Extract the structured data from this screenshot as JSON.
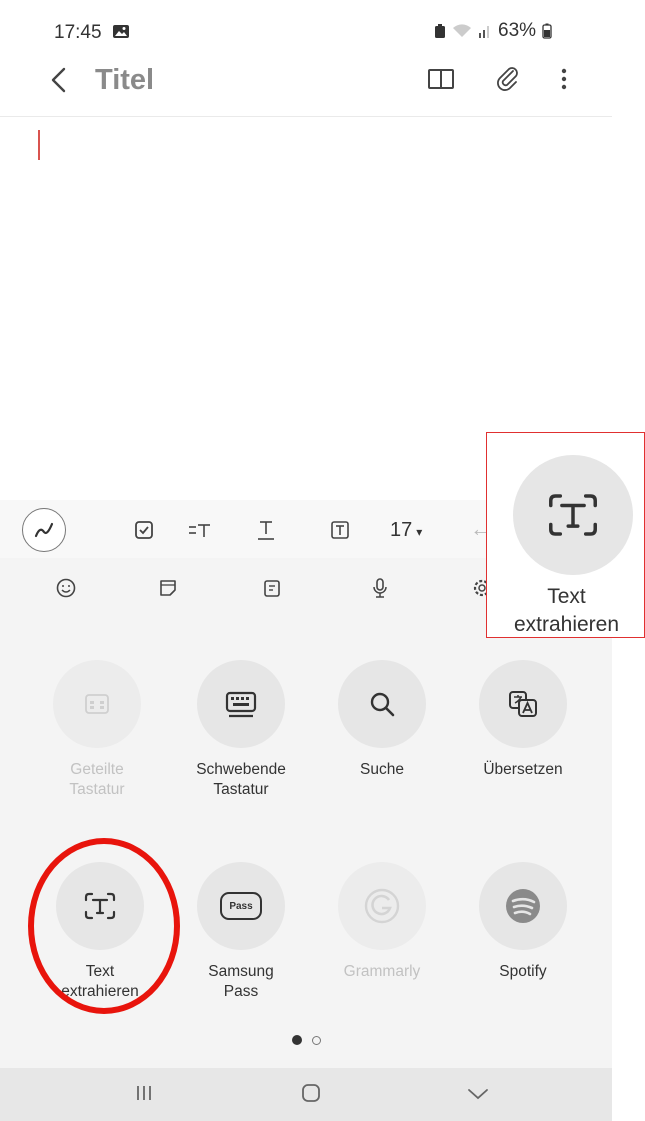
{
  "status_bar": {
    "time": "17:45",
    "battery": "63%"
  },
  "header": {
    "title": "Titel"
  },
  "toolbar": {
    "font_size": "17"
  },
  "apps_row1": [
    {
      "label_line1": "Geteilte",
      "label_line2": "Tastatur",
      "enabled": false,
      "icon": "split-keyboard-icon"
    },
    {
      "label_line1": "Schwebende",
      "label_line2": "Tastatur",
      "enabled": true,
      "icon": "floating-keyboard-icon"
    },
    {
      "label_line1": "Suche",
      "label_line2": "",
      "enabled": true,
      "icon": "search-icon"
    },
    {
      "label_line1": "Übersetzen",
      "label_line2": "",
      "enabled": true,
      "icon": "translate-icon"
    }
  ],
  "apps_row2": [
    {
      "label_line1": "Text",
      "label_line2": "extrahieren",
      "enabled": true,
      "icon": "extract-text-icon"
    },
    {
      "label_line1": "Samsung",
      "label_line2": "Pass",
      "enabled": true,
      "icon": "samsung-pass-icon",
      "badge": "Pass"
    },
    {
      "label_line1": "Grammarly",
      "label_line2": "",
      "enabled": false,
      "icon": "grammarly-icon"
    },
    {
      "label_line1": "Spotify",
      "label_line2": "",
      "enabled": true,
      "icon": "spotify-icon"
    }
  ],
  "pagination": {
    "current": 1,
    "total": 2
  },
  "callout": {
    "label_line1": "Text",
    "label_line2": "extrahieren"
  },
  "colors": {
    "annotation": "#e8140c",
    "cursor": "#d9534f"
  }
}
